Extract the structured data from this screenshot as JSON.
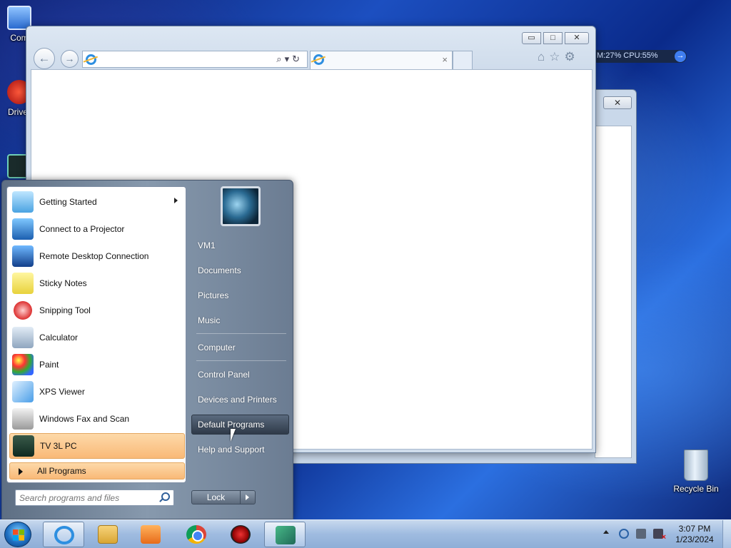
{
  "desktop": {
    "icons": [
      {
        "label": "Com"
      },
      {
        "label": "Driver"
      },
      {
        "label": ""
      },
      {
        "label": "Recycle Bin"
      }
    ],
    "gadget": {
      "text": "M:27%  CPU:55%"
    }
  },
  "browser": {
    "address_value": "",
    "tab_title": "",
    "close_tab": "×",
    "caption": {
      "min": "▭",
      "max": "□",
      "close": "✕"
    },
    "address_tools": "⌕▾↻",
    "tool_icons": "⌂☆⚙"
  },
  "bg_window": {
    "close": "✕"
  },
  "start_menu": {
    "programs": [
      {
        "label": "Getting Started",
        "has_submenu": true,
        "icon": "getting-started-icon"
      },
      {
        "label": "Connect to a Projector",
        "icon": "projector-icon"
      },
      {
        "label": "Remote Desktop Connection",
        "icon": "remote-desktop-icon"
      },
      {
        "label": "Sticky Notes",
        "icon": "sticky-notes-icon"
      },
      {
        "label": "Snipping Tool",
        "icon": "snipping-tool-icon"
      },
      {
        "label": "Calculator",
        "icon": "calculator-icon"
      },
      {
        "label": "Paint",
        "icon": "paint-icon"
      },
      {
        "label": "XPS Viewer",
        "icon": "xps-viewer-icon"
      },
      {
        "label": "Windows Fax and Scan",
        "icon": "fax-scan-icon"
      },
      {
        "label": "TV 3L PC",
        "icon": "tv3l-icon",
        "highlighted": true
      }
    ],
    "all_programs": "All Programs",
    "search_placeholder": "Search programs and files",
    "right": [
      {
        "label": "VM1"
      },
      {
        "label": "Documents"
      },
      {
        "label": "Pictures"
      },
      {
        "label": "Music"
      },
      {
        "label": "Computer"
      },
      {
        "label": "Control Panel"
      },
      {
        "label": "Devices and Printers"
      },
      {
        "label": "Default Programs",
        "hover": true
      },
      {
        "label": "Help and Support"
      }
    ],
    "lock": "Lock"
  },
  "taskbar": {
    "clock_time": "3:07 PM",
    "clock_date": "1/23/2024"
  },
  "colors": {
    "highlight": "#f9b977",
    "taskbar": "#9fbbe0",
    "accent": "#2e8fe0"
  }
}
